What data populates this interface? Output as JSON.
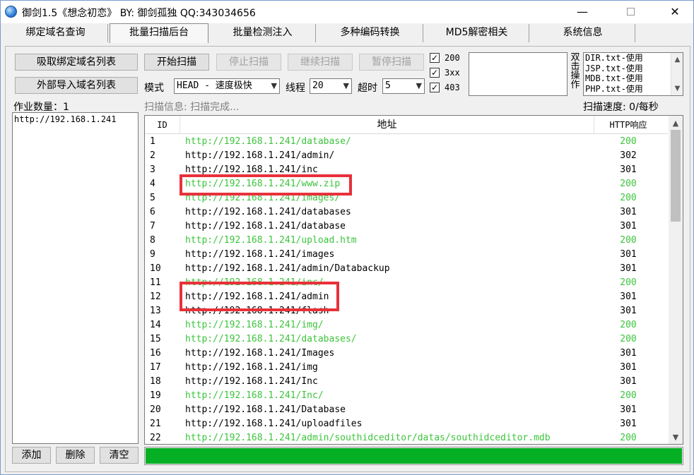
{
  "window": {
    "title": "御剑1.5《想念初恋》 BY: 御剑孤独 QQ:343034656",
    "minimize": "—",
    "close": "✕"
  },
  "tabs": [
    {
      "label": "绑定域名查询",
      "active": false
    },
    {
      "label": "批量扫描后台",
      "active": true
    },
    {
      "label": "批量检测注入",
      "active": false
    },
    {
      "label": "多种编码转换",
      "active": false
    },
    {
      "label": "MD5解密相关",
      "active": false
    },
    {
      "label": "系统信息",
      "active": false
    }
  ],
  "left_panel": {
    "fetch_button": "吸取绑定域名列表",
    "import_button": "外部导入域名列表",
    "task_count_label": "作业数量：1",
    "tasks": [
      "http://192.168.1.241"
    ],
    "add_button": "添加",
    "delete_button": "删除",
    "clear_button": "清空"
  },
  "controls": {
    "start_button": "开始扫描",
    "stop_button": "停止扫描",
    "continue_button": "继续扫描",
    "pause_button": "暂停扫描",
    "mode_label": "模式",
    "mode_value": "HEAD - 速度极快",
    "threads_label": "线程",
    "threads_value": "20",
    "timeout_label": "超时",
    "timeout_value": "5",
    "status_200": "200",
    "status_3xx": "3xx",
    "status_403": "403",
    "dict_label": [
      "双",
      "击",
      "操",
      "作"
    ],
    "dictionaries": [
      "DIR.txt-使用",
      "JSP.txt-使用",
      "MDB.txt-使用",
      "PHP.txt-使用"
    ],
    "scan_info": "扫描信息: 扫描完成...",
    "scan_speed": "扫描速度: 0/每秒"
  },
  "results": {
    "headers": {
      "id": "ID",
      "url": "地址",
      "code": "HTTP响应"
    },
    "rows": [
      {
        "id": "1",
        "url": "http://192.168.1.241/database/",
        "code": "200"
      },
      {
        "id": "2",
        "url": "http://192.168.1.241/admin/",
        "code": "302"
      },
      {
        "id": "3",
        "url": "http://192.168.1.241/inc",
        "code": "301"
      },
      {
        "id": "4",
        "url": "http://192.168.1.241/www.zip",
        "code": "200"
      },
      {
        "id": "5",
        "url": "http://192.168.1.241/images/",
        "code": "200"
      },
      {
        "id": "6",
        "url": "http://192.168.1.241/databases",
        "code": "301"
      },
      {
        "id": "7",
        "url": "http://192.168.1.241/database",
        "code": "301"
      },
      {
        "id": "8",
        "url": "http://192.168.1.241/upload.htm",
        "code": "200"
      },
      {
        "id": "9",
        "url": "http://192.168.1.241/images",
        "code": "301"
      },
      {
        "id": "10",
        "url": "http://192.168.1.241/admin/Databackup",
        "code": "301"
      },
      {
        "id": "11",
        "url": "http://192.168.1.241/inc/",
        "code": "200"
      },
      {
        "id": "12",
        "url": "http://192.168.1.241/admin",
        "code": "301"
      },
      {
        "id": "13",
        "url": "http://192.168.1.241/flash",
        "code": "301"
      },
      {
        "id": "14",
        "url": "http://192.168.1.241/img/",
        "code": "200"
      },
      {
        "id": "15",
        "url": "http://192.168.1.241/databases/",
        "code": "200"
      },
      {
        "id": "16",
        "url": "http://192.168.1.241/Images",
        "code": "301"
      },
      {
        "id": "17",
        "url": "http://192.168.1.241/img",
        "code": "301"
      },
      {
        "id": "18",
        "url": "http://192.168.1.241/Inc",
        "code": "301"
      },
      {
        "id": "19",
        "url": "http://192.168.1.241/Inc/",
        "code": "200"
      },
      {
        "id": "20",
        "url": "http://192.168.1.241/Database",
        "code": "301"
      },
      {
        "id": "21",
        "url": "http://192.168.1.241/uploadfiles",
        "code": "301"
      },
      {
        "id": "22",
        "url": "http://192.168.1.241/admin/southidceditor/datas/southidceditor.mdb",
        "code": "200"
      }
    ]
  },
  "progress": {
    "percent": 100
  },
  "colors": {
    "success_text": "#3cc43c",
    "progress_fill": "#06b025",
    "highlight": "#e8313a"
  }
}
